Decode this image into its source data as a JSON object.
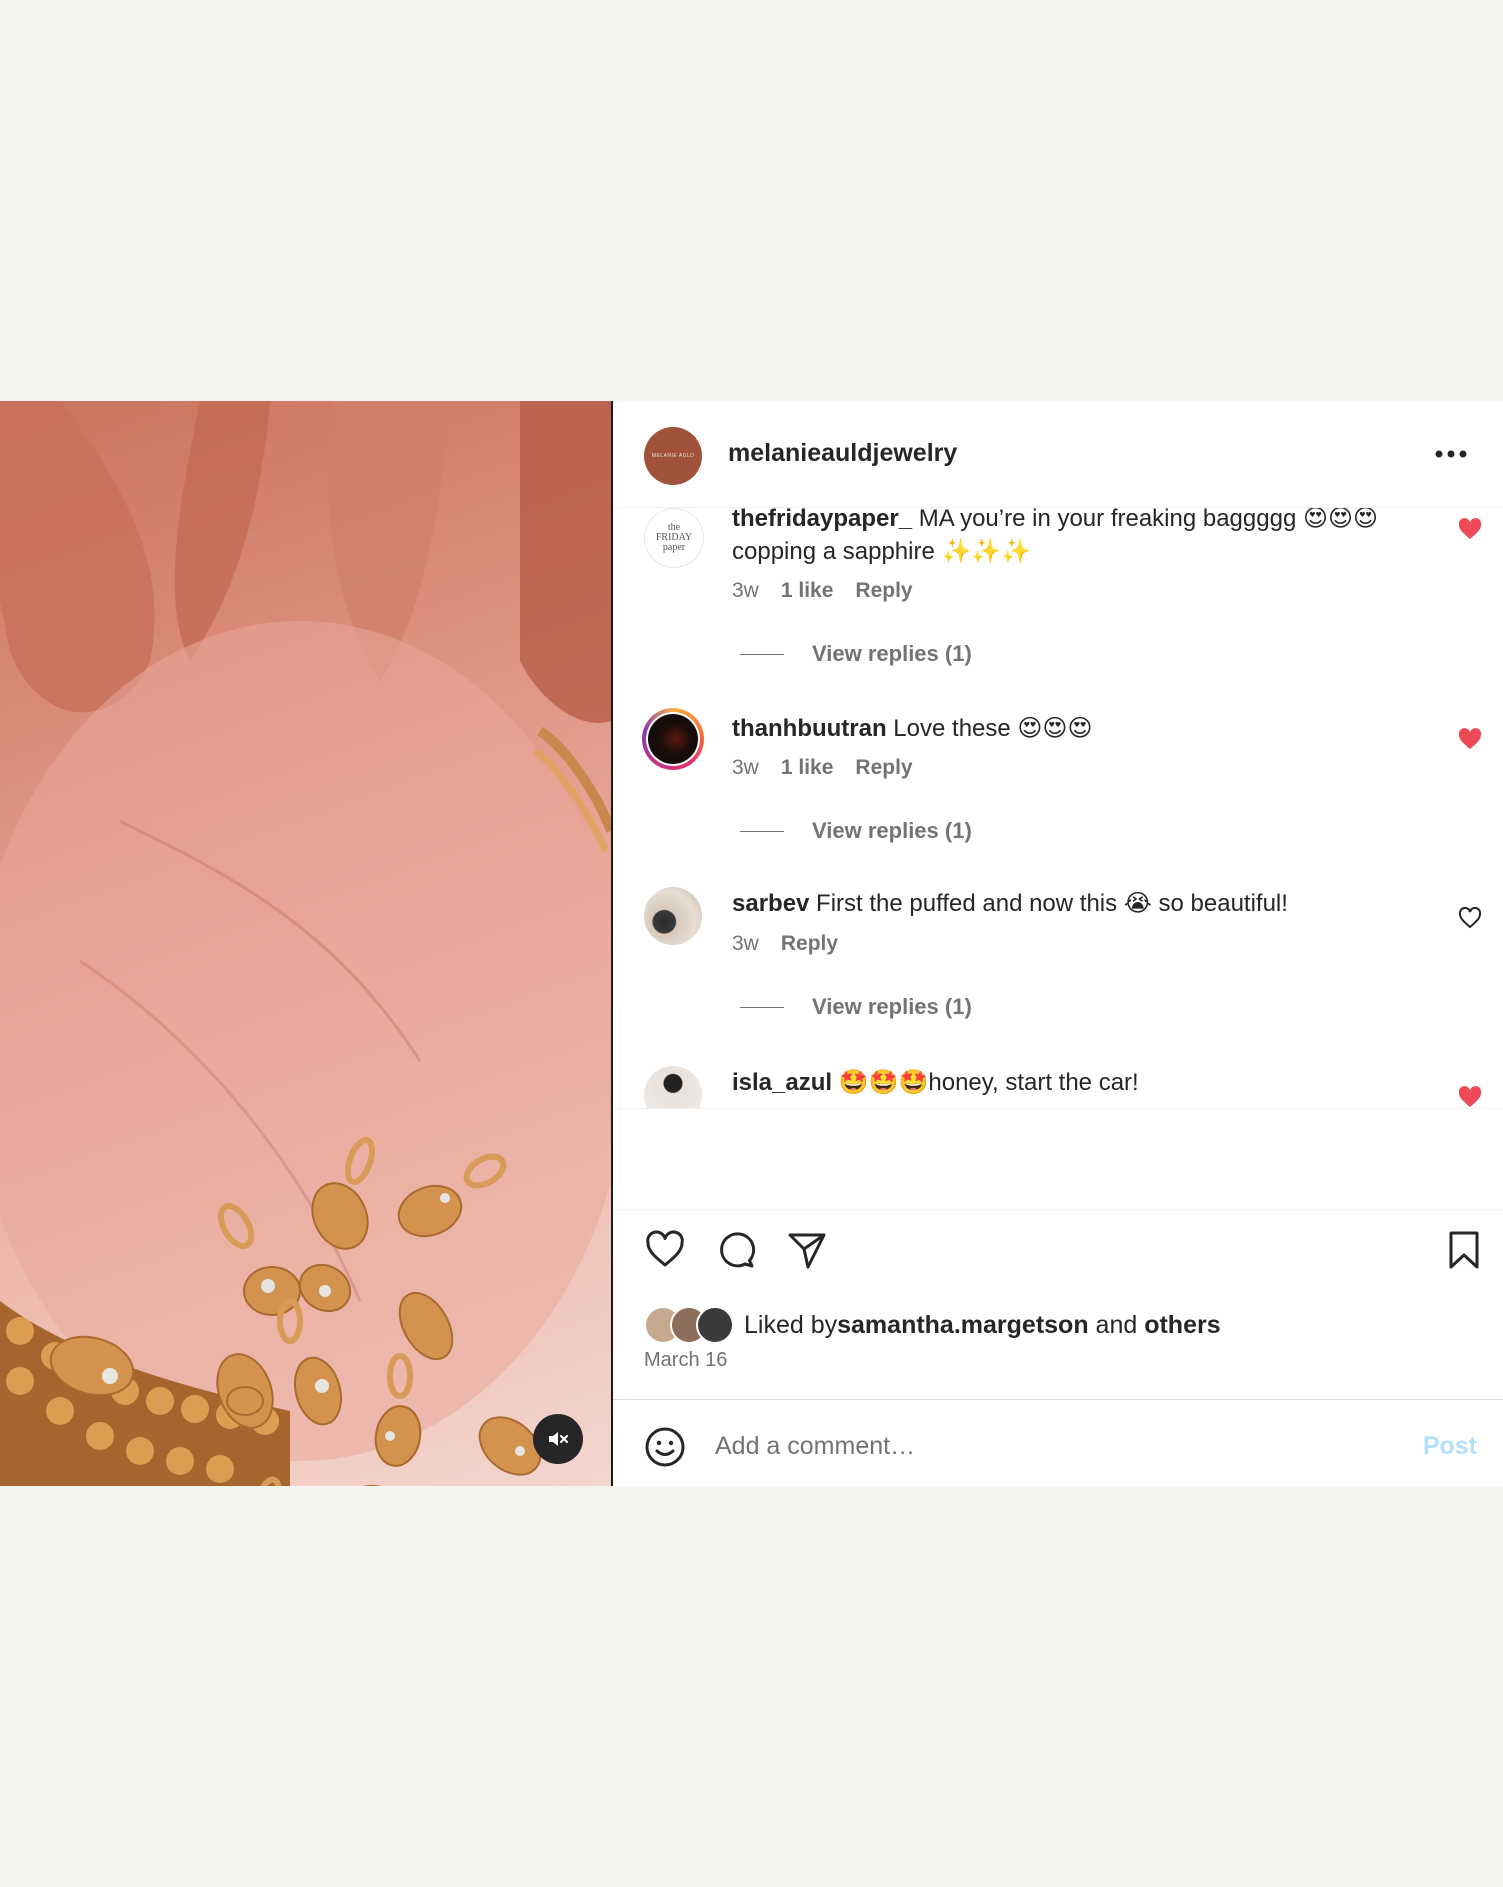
{
  "post": {
    "author": "melanieauldjewelry",
    "author_avatar_text": "MELANIE AULD",
    "more_icon": "more-horizontal-icon",
    "mute_icon": "speaker-muted-icon"
  },
  "comments": [
    {
      "user": "thefridaypaper_",
      "text": " MA you’re in your freaking baggggg 😍😍😍 copping a sapphire ✨✨✨",
      "time": "3w",
      "likes": "1 like",
      "reply": "Reply",
      "view_replies": "View replies (1)",
      "liked": true,
      "avatar_text": "the FRIDAY paper"
    },
    {
      "user": "thanhbuutran",
      "text": " Love these 😍😍😍",
      "time": "3w",
      "likes": "1 like",
      "reply": "Reply",
      "view_replies": "View replies (1)",
      "liked": true
    },
    {
      "user": "sarbev",
      "text": " First the puffed and now this 😭 so beautiful!",
      "time": "3w",
      "likes": "",
      "reply": "Reply",
      "view_replies": "View replies (1)",
      "liked": false
    },
    {
      "user": "isla_azul",
      "text": " 🤩🤩🤩honey, start the car!",
      "liked": true
    }
  ],
  "actions": {
    "like_icon": "heart-icon",
    "comment_icon": "comment-icon",
    "share_icon": "send-icon",
    "save_icon": "bookmark-icon"
  },
  "likes": {
    "prefix": "Liked by ",
    "user": "samantha.margetson",
    "middle": " and ",
    "others": "others"
  },
  "date": "March 16",
  "add_comment": {
    "placeholder": "Add a comment…",
    "post_label": "Post"
  },
  "colors": {
    "heart_active": "#ed4956",
    "post_disabled": "#b2dffc",
    "avatar_brand": "#a0523a"
  }
}
